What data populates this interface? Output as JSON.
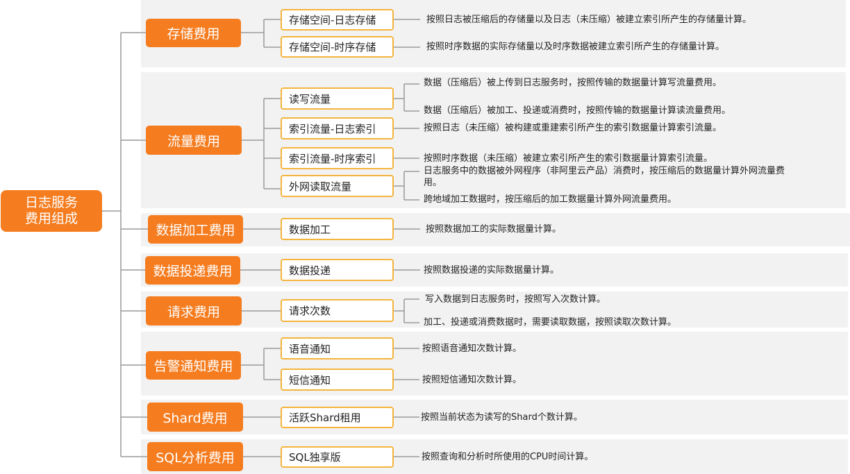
{
  "root": {
    "label": "日志服务\n费用组成"
  },
  "categories": [
    {
      "label": "存储费用",
      "items": [
        {
          "label": "存储空间-日志存储",
          "descs": [
            "按照日志被压缩后的存储量以及日志（未压缩）被建立索引所产生的存储量计算。"
          ]
        },
        {
          "label": "存储空间-时序存储",
          "descs": [
            "按照时序数据的实际存储量以及时序数据被建立索引所产生的存储量计算。"
          ]
        }
      ]
    },
    {
      "label": "流量费用",
      "items": [
        {
          "label": "读写流量",
          "descs": [
            "数据（压缩后）被上传到日志服务时，按照传输的数据量计算写流量费用。",
            "数据（压缩后）被加工、投递或消费时，按照传输的数据量计算读流量费用。"
          ]
        },
        {
          "label": "索引流量-日志索引",
          "descs": [
            "按照日志（未压缩）被构建或重建索引所产生的索引数据量计算索引流量。"
          ]
        },
        {
          "label": "索引流量-时序索引",
          "descs": [
            "按照时序数据（未压缩）被建立索引所产生的索引数据量计算索引流量。"
          ]
        },
        {
          "label": "外网读取流量",
          "descs": [
            "日志服务中的数据被外网程序（非阿里云产品）消费时，按压缩后的数据量计算外网流量费用。",
            "跨地域加工数据时，按压缩后的加工数据量计算外网流量费用。"
          ]
        }
      ]
    },
    {
      "label": "数据加工费用",
      "items": [
        {
          "label": "数据加工",
          "descs": [
            "按照数据加工的实际数据量计算。"
          ]
        }
      ]
    },
    {
      "label": "数据投递费用",
      "items": [
        {
          "label": "数据投递",
          "descs": [
            "按照数据投递的实际数据量计算。"
          ]
        }
      ]
    },
    {
      "label": "请求费用",
      "items": [
        {
          "label": "请求次数",
          "descs": [
            "写入数据到日志服务时，按照写入次数计算。",
            "加工、投递或消费数据时，需要读取数据，按照读取次数计算。"
          ]
        }
      ]
    },
    {
      "label": "告警通知费用",
      "items": [
        {
          "label": "语音通知",
          "descs": [
            "按照语音通知次数计算。"
          ]
        },
        {
          "label": "短信通知",
          "descs": [
            "按照短信通知次数计算。"
          ]
        }
      ]
    },
    {
      "label": "Shard费用",
      "items": [
        {
          "label": "活跃Shard租用",
          "descs": [
            "按照当前状态为读写的Shard个数计算。"
          ]
        }
      ]
    },
    {
      "label": "SQL分析费用",
      "items": [
        {
          "label": "SQL独享版",
          "descs": [
            "按照查询和分析时所使用的CPU时间计算。"
          ]
        }
      ]
    }
  ],
  "colors": {
    "accent": "#f57c1f",
    "leaf_border": "#f5b43c",
    "panel": "#f2f2f2",
    "line": "#999999"
  }
}
